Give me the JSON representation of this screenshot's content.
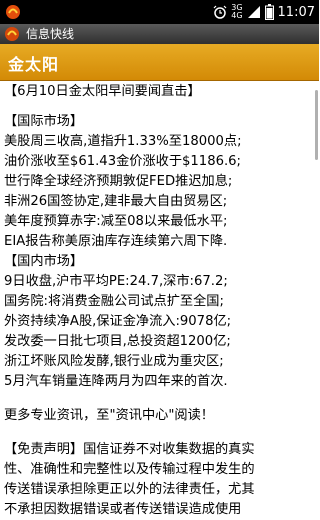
{
  "status_bar": {
    "network_top": "3G",
    "network_bottom": "4G",
    "time": "11:07"
  },
  "app_bar": {
    "title": "信息快线"
  },
  "header": {
    "title": "金太阳"
  },
  "article": {
    "title": "【6月10日金太阳早间要闻直击】",
    "intl_heading": "【国际市场】",
    "intl_items": [
      "美股周三收高,道指升1.33%至18000点;",
      "油价涨收至$61.43金价涨收于$1186.6;",
      "世行降全球经济预期敦促FED推迟加息;",
      "非洲26国签协定,建非最大自由贸易区;",
      "美年度预算赤字:减至08以来最低水平;",
      "EIA报告称美原油库存连续第六周下降."
    ],
    "domestic_heading": "【国内市场】",
    "domestic_items": [
      "9日收盘,沪市平均PE:24.7,深市:67.2;",
      "国务院:将消费金融公司试点扩至全国;",
      "外资持续净A股,保证金净流入:9078亿;",
      "发改委一日批七项目,总投资超1200亿;",
      "浙江坏账风险发酵,银行业成为重灾区;",
      "5月汽车销量连降两月为四年来的首次."
    ],
    "more_info": "更多专业资讯，至\"资讯中心\"阅读！",
    "disclaimer_lines": [
      "【免责声明】国信证券不对收集数据的真实",
      "性、准确性和完整性以及传输过程中发生的",
      "传送错误承担除更正以外的法律责任，尤其",
      "不承担因数据错误或者传送错误造成使用"
    ]
  }
}
